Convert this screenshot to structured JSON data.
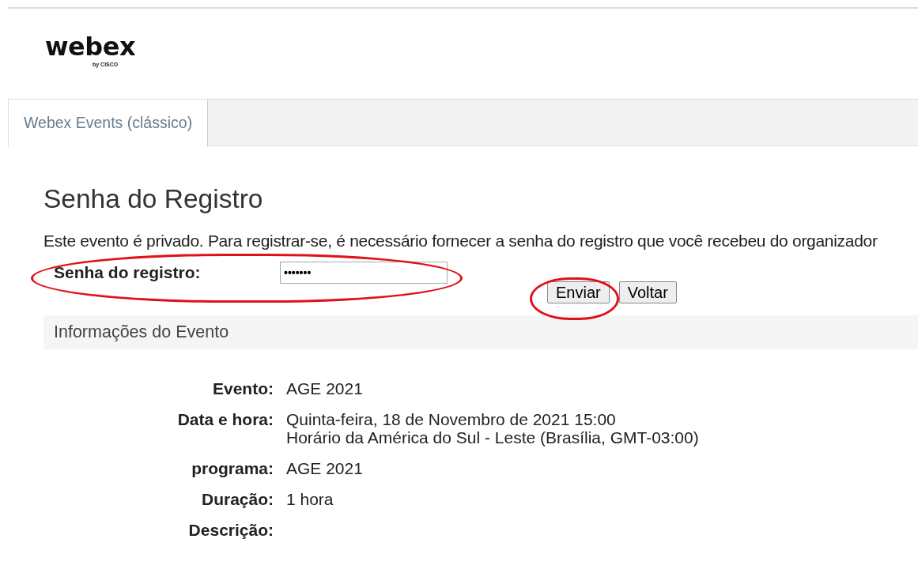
{
  "logo": {
    "wordmark": "webex",
    "byline": "by CISCO"
  },
  "tabs": [
    {
      "label": "Webex Events (clássico)",
      "selected": true
    }
  ],
  "heading": "Senha do Registro",
  "intro": "Este evento é privado. Para registrar-se, é necessário fornecer a senha do registro que você recebeu do organizador",
  "password_field": {
    "label": "Senha do registro:",
    "value": "•••••••"
  },
  "buttons": [
    {
      "label": "Enviar",
      "highlighted": true
    },
    {
      "label": "Voltar",
      "highlighted": false
    }
  ],
  "field_highlighted": true,
  "section_title": "Informações do Evento",
  "details": [
    {
      "label": "Evento:",
      "lines": [
        "AGE 2021"
      ]
    },
    {
      "label": "Data e hora:",
      "lines": [
        "Quinta-feira, 18 de Novembro de 2021 15:00",
        "Horário da América do Sul - Leste (Brasília, GMT-03:00)"
      ]
    },
    {
      "label": "programa:",
      "lines": [
        "AGE 2021"
      ]
    },
    {
      "label": "Duração:",
      "lines": [
        "1 hora"
      ]
    },
    {
      "label": "Descrição:"
    }
  ]
}
